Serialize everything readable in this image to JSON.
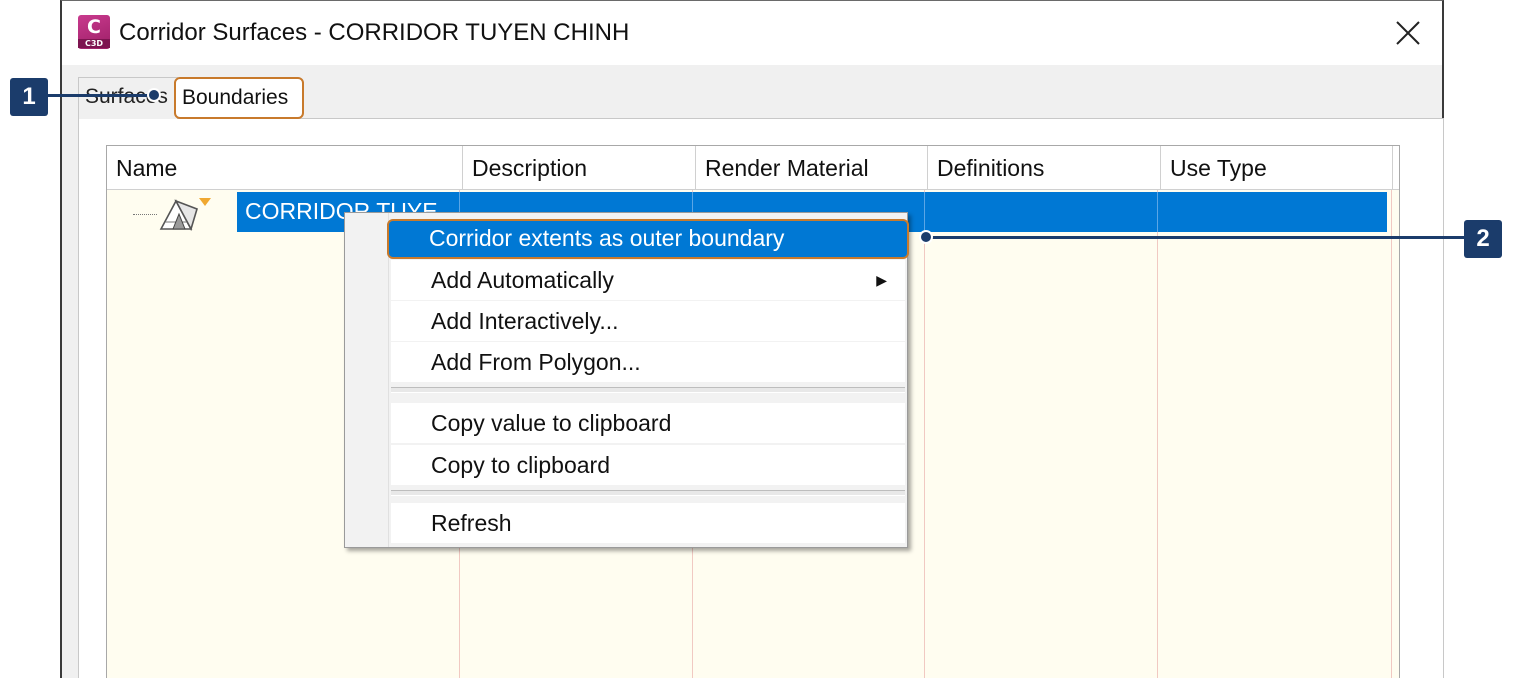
{
  "window": {
    "title": "Corridor Surfaces - CORRIDOR TUYEN CHINH",
    "app_icon_letter": "C",
    "app_icon_sub": "C3D",
    "app_icon_color": "#b52b7c"
  },
  "tabs": [
    {
      "label": "Surfaces",
      "active": false
    },
    {
      "label": "Boundaries",
      "active": true
    }
  ],
  "grid": {
    "columns": [
      "Name",
      "Description",
      "Render Material",
      "Definitions",
      "Use Type"
    ],
    "rows": [
      {
        "name": "CORRIDOR TUYE",
        "selected": true,
        "icon": "corridor-surface-icon"
      }
    ]
  },
  "context_menu": {
    "items": [
      {
        "label": "Corridor extents as outer boundary",
        "highlighted": true
      },
      {
        "label": "Add Automatically",
        "submenu": true
      },
      {
        "label": "Add Interactively..."
      },
      {
        "label": "Add From Polygon..."
      },
      {
        "label": "Copy value to clipboard"
      },
      {
        "label": "Copy to clipboard"
      },
      {
        "label": "Refresh"
      }
    ]
  },
  "callouts": [
    "1",
    "2"
  ],
  "colors": {
    "selection": "#0078d4",
    "highlight_border": "#c87a2c",
    "callout": "#1b3c6b",
    "grid_background": "#fffdf0"
  }
}
